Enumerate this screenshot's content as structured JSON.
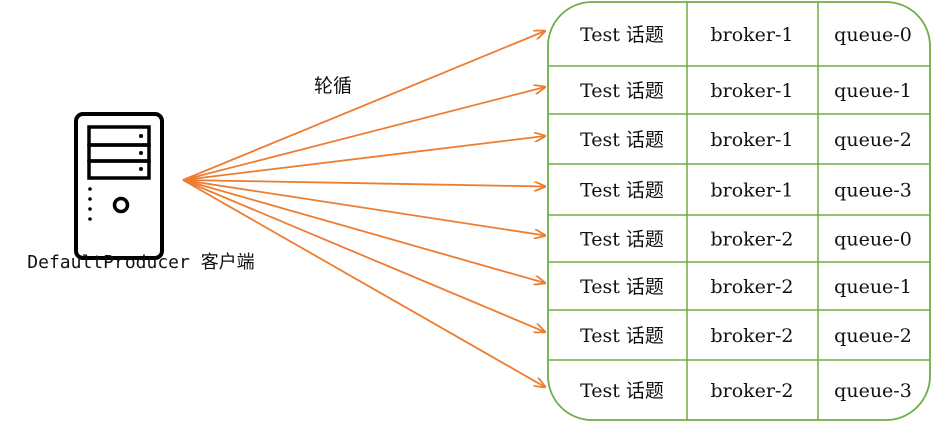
{
  "client": {
    "label": "DefaultProducer 客户端",
    "icon": "server-tower-icon"
  },
  "strategy_label": "轮循",
  "queues": [
    {
      "topic": "Test 话题",
      "broker": "broker-1",
      "queue": "queue-0"
    },
    {
      "topic": "Test 话题",
      "broker": "broker-1",
      "queue": "queue-1"
    },
    {
      "topic": "Test 话题",
      "broker": "broker-1",
      "queue": "queue-2"
    },
    {
      "topic": "Test 话题",
      "broker": "broker-1",
      "queue": "queue-3"
    },
    {
      "topic": "Test 话题",
      "broker": "broker-2",
      "queue": "queue-0"
    },
    {
      "topic": "Test 话题",
      "broker": "broker-2",
      "queue": "queue-1"
    },
    {
      "topic": "Test 话题",
      "broker": "broker-2",
      "queue": "queue-2"
    },
    {
      "topic": "Test 话题",
      "broker": "broker-2",
      "queue": "queue-3"
    }
  ],
  "colors": {
    "arrow": "#ED7D31",
    "table_border": "#70AD47",
    "icon": "#000000",
    "text": "#111111"
  }
}
